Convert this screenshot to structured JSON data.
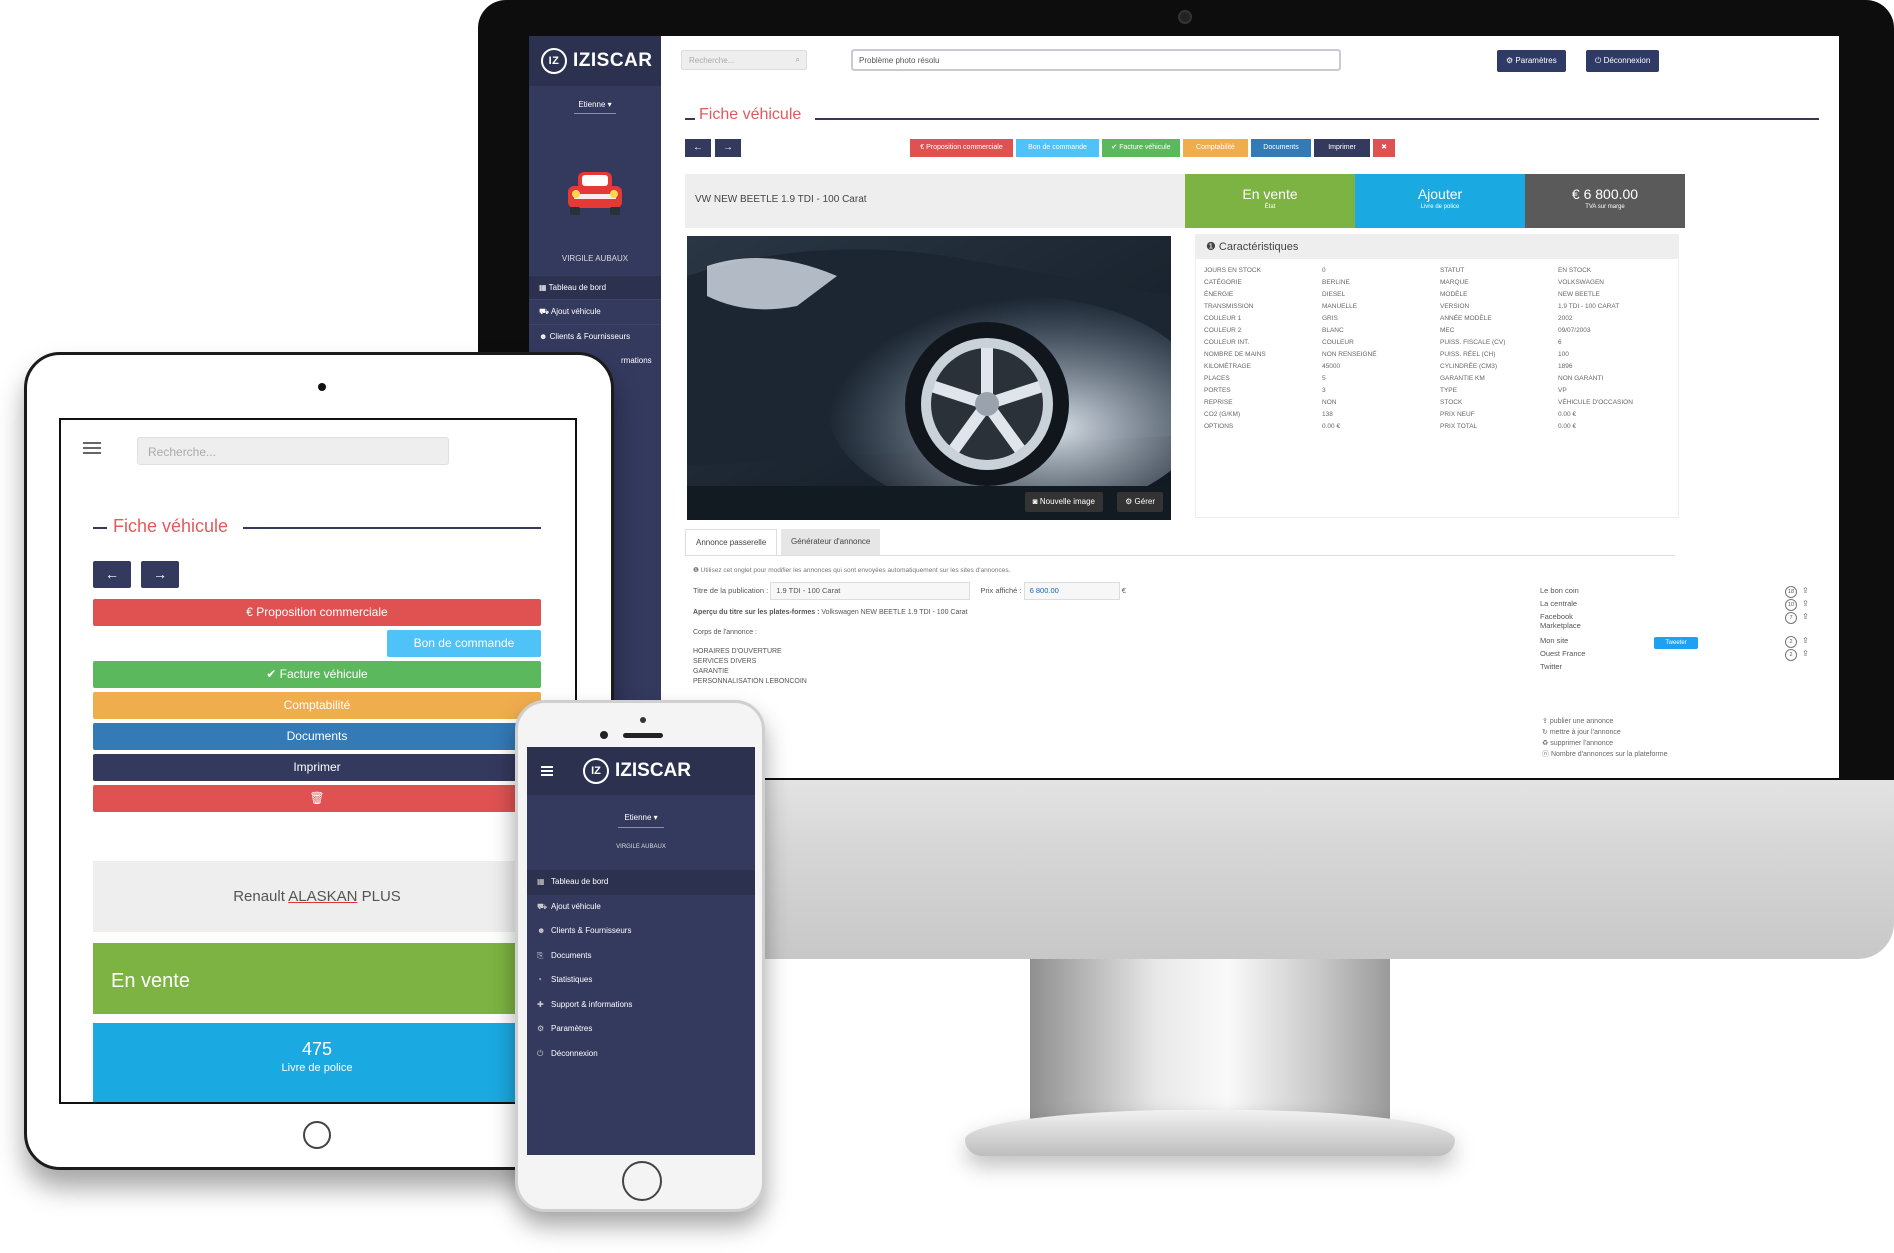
{
  "colors": {
    "navy": "#34395e",
    "navy_dark": "#2c3150",
    "red": "#e05252",
    "cyan": "#4fc3f7",
    "green": "#5cb85c",
    "orange": "#f0ad4e",
    "blue": "#337ab7",
    "olive_green": "#7cb342",
    "sky": "#1ba9e1",
    "gray_tile": "#5a5a5a"
  },
  "desktop": {
    "logo": "IZISCAR",
    "logo_mark": "IZ",
    "user_dropdown": "Etienne ▾",
    "garage_name": "VIRGILE AUBAUX",
    "menu": [
      {
        "icon": "dashboard-icon",
        "label": "Tableau de bord"
      },
      {
        "icon": "car-icon",
        "label": "Ajout véhicule"
      },
      {
        "icon": "users-icon",
        "label": "Clients & Fournisseurs"
      }
    ],
    "menu_partial": "rmations",
    "search_placeholder": "Recherche...",
    "message_value": "Problème photo résolu",
    "params_button": "Paramètres",
    "logout_button": "Déconnexion",
    "page_title": "Fiche véhicule",
    "nav_prev": "←",
    "nav_next": "→",
    "actions": [
      {
        "label": "€ Proposition commerciale",
        "color": "#e05252"
      },
      {
        "label": "Bon de commande",
        "color": "#4fc3f7"
      },
      {
        "label": "✔ Facture véhicule",
        "color": "#5cb85c"
      },
      {
        "label": "Comptabilité",
        "color": "#f0ad4e"
      },
      {
        "label": "Documents",
        "color": "#337ab7"
      },
      {
        "label": "Imprimer",
        "color": "#34395e"
      },
      {
        "label": "✖",
        "color": "#e05252"
      }
    ],
    "vehicle_name": "VW NEW BEETLE 1.9 TDI - 100 Carat",
    "tiles": [
      {
        "title": "En vente",
        "sub": "État",
        "color": "#7cb342"
      },
      {
        "title": "Ajouter",
        "sub": "Livre de police",
        "color": "#1ba9e1"
      },
      {
        "title": "€ 6 800.00",
        "sub": "TVA sur marge",
        "color": "#5a5a5a"
      }
    ],
    "new_image_button": "Nouvelle image",
    "manage_button": "Gérer",
    "specs_title": "Caractéristiques",
    "specs": [
      [
        "Jours en stock",
        "0",
        "Statut",
        "En stock"
      ],
      [
        "Catégorie",
        "Berline",
        "Marque",
        "Volkswagen"
      ],
      [
        "Énergie",
        "Diesel",
        "Modèle",
        "New Beetle"
      ],
      [
        "Transmission",
        "Manuelle",
        "Version",
        "1.9 TDI - 100 Carat"
      ],
      [
        "Couleur 1",
        "Gris",
        "Année modèle",
        "2002"
      ],
      [
        "Couleur 2",
        "Blanc",
        "MEC",
        "09/07/2003"
      ],
      [
        "Couleur int.",
        "Couleur",
        "Puiss. fiscale (CV)",
        "6"
      ],
      [
        "Nombre de mains",
        "Non renseigné",
        "Puiss. réel (CH)",
        "100"
      ],
      [
        "Kilométrage",
        "45000",
        "Cylindrée (CM3)",
        "1896"
      ],
      [
        "Places",
        "5",
        "Garantie KM",
        "Non garanti"
      ],
      [
        "Portes",
        "3",
        "Type",
        "VP"
      ],
      [
        "Reprise",
        "Non",
        "Stock",
        "Véhicule d'occasion"
      ],
      [
        "CO2 (g/km)",
        "138",
        "Prix neuf",
        "0.00 €"
      ],
      [
        "Options",
        "0.00 €",
        "Prix total",
        "0.00 €"
      ]
    ],
    "tabs": [
      "Annonce passerelle",
      "Générateur d'annonce"
    ],
    "info_text": "Utilisez cet onglet pour modifier les annonces qui sont envoyées automatiquement sur les sites d'annonces.",
    "pub_title_label": "Titre de la publication :",
    "pub_title_value": "1.9 TDI - 100 Carat",
    "price_label": "Prix affiché :",
    "price_value": "6 800.00",
    "price_unit": "€",
    "preview_label": "Aperçu du titre sur les plates-formes :",
    "preview_value": "Volkswagen NEW BEETLE 1.9 TDI - 100 Carat",
    "body_label": "Corps de l'annonce :",
    "body_lines": [
      "HORAIRES D'OUVERTURE",
      "SERVICES DIVERS",
      "GARANTIE",
      "PERSONNALISATION LEBONCOIN"
    ],
    "platforms": [
      {
        "name": "Le bon coin",
        "count": "18"
      },
      {
        "name": "La centrale",
        "count": "10"
      },
      {
        "name": "Facebook Marketplace",
        "count": "7"
      },
      {
        "name": "Mon site",
        "count": "2"
      },
      {
        "name": "Ouest France",
        "count": "2"
      },
      {
        "name": "Twitter",
        "count": ""
      }
    ],
    "twitter_button": "Tweeter",
    "legend": [
      "publier une annonce",
      "mettre à jour l'annonce",
      "supprimer l'annonce",
      "Nombre d'annonces sur la plateforme"
    ]
  },
  "tablet": {
    "search_placeholder": "Recherche...",
    "page_title": "Fiche véhicule",
    "nav_prev": "←",
    "nav_next": "→",
    "buttons": [
      {
        "label": "€ Proposition commerciale",
        "color": "#e05252"
      },
      {
        "label": "Bon de commande",
        "color": "#4fc3f7"
      },
      {
        "label": "✔ Facture véhicule",
        "color": "#5cb85c"
      },
      {
        "label": "Comptabilité",
        "color": "#f0ad4e"
      },
      {
        "label": "Documents",
        "color": "#337ab7"
      },
      {
        "label": "Imprimer",
        "color": "#34395e"
      },
      {
        "label": "🗑",
        "color": "#e05252"
      }
    ],
    "vehicle_prefix": "Renault ",
    "vehicle_model": "ALASKAN",
    "vehicle_suffix": " PLUS",
    "status": "En vente",
    "police_number": "475",
    "police_label": "Livre de police"
  },
  "phone": {
    "logo": "IZISCAR",
    "logo_mark": "IZ",
    "user_dropdown": "Etienne ▾",
    "garage_name": "VIRGILE AUBAUX",
    "menu": [
      {
        "icon": "dashboard-icon",
        "glyph": "▦",
        "label": "Tableau de bord"
      },
      {
        "icon": "car-icon",
        "glyph": "⛟",
        "label": "Ajout véhicule"
      },
      {
        "icon": "users-icon",
        "glyph": "☻",
        "label": "Clients & Fournisseurs"
      },
      {
        "icon": "documents-icon",
        "glyph": "⎘",
        "label": "Documents"
      },
      {
        "icon": "stats-icon",
        "glyph": "◔",
        "label": "Statistiques"
      },
      {
        "icon": "support-icon",
        "glyph": "✚",
        "label": "Support & informations"
      },
      {
        "icon": "gear-icon",
        "glyph": "⚙",
        "label": "Paramètres"
      },
      {
        "icon": "power-icon",
        "glyph": "⏻",
        "label": "Déconnexion"
      }
    ]
  }
}
